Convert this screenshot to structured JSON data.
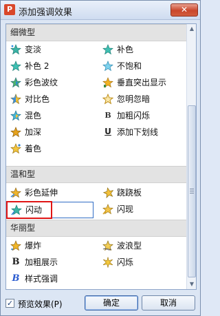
{
  "window": {
    "title": "添加强调效果",
    "app_icon": "P",
    "close_label": "✕"
  },
  "categories": [
    {
      "name": "细微型",
      "items": [
        {
          "label": "变淡",
          "icon": "sparkle-star-teal-icon"
        },
        {
          "label": "补色",
          "icon": "star-teal-icon"
        },
        {
          "label": "补色 2",
          "icon": "star-teal-icon"
        },
        {
          "label": "不饱和",
          "icon": "star-teal-icon"
        },
        {
          "label": "彩色波纹",
          "icon": "star-multicolor-icon"
        },
        {
          "label": "垂直突出显示",
          "icon": "star-gold-icon"
        },
        {
          "label": "对比色",
          "icon": "star-blue-icon"
        },
        {
          "label": "忽明忽暗",
          "icon": "star-outline-icon"
        },
        {
          "label": "混色",
          "icon": "star-blue-icon"
        },
        {
          "label": "加粗闪烁",
          "icon": "bold-b-icon"
        },
        {
          "label": "加深",
          "icon": "star-gold-icon"
        },
        {
          "label": "添加下划线",
          "icon": "underline-u-icon"
        },
        {
          "label": "着色",
          "icon": "star-gold-icon"
        }
      ]
    },
    {
      "name": "温和型",
      "items": [
        {
          "label": "彩色延伸",
          "icon": "star-gold-icon"
        },
        {
          "label": "跷跷板",
          "icon": "star-wobble-icon"
        },
        {
          "label": "闪动",
          "icon": "sparkle-star-teal-icon",
          "selected": true
        },
        {
          "label": "闪现",
          "icon": "sparkle-star-gold-icon"
        }
      ]
    },
    {
      "name": "华丽型",
      "items": [
        {
          "label": "爆炸",
          "icon": "star-gold-icon"
        },
        {
          "label": "波浪型",
          "icon": "star-wave-icon"
        },
        {
          "label": "加粗展示",
          "icon": "bold-b-icon"
        },
        {
          "label": "闪烁",
          "icon": "star-burst-icon"
        },
        {
          "label": "样式强调",
          "icon": "bold-b-blue-icon"
        }
      ]
    }
  ],
  "footer": {
    "preview_label": "预览效果(P)",
    "preview_checked": true,
    "ok_label": "确定",
    "cancel_label": "取消"
  },
  "colors": {
    "accent_selection": "#2f6cc4",
    "highlight_box": "#e01414",
    "category_bg": "#e3e3e3"
  }
}
